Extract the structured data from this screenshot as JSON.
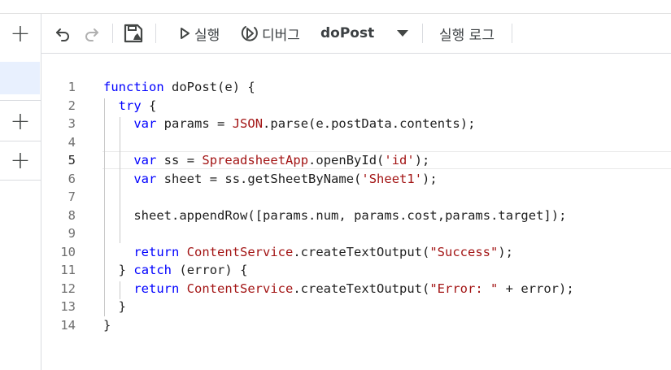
{
  "sidebar": {
    "add_label": "+",
    "add_label_2": "+",
    "add_label_3": "+"
  },
  "toolbar": {
    "undo_icon": "undo-icon",
    "redo_icon": "redo-icon",
    "save_icon": "save-to-drive-icon",
    "run_icon": "play-icon",
    "run_label": "실행",
    "debug_icon": "debug-icon",
    "debug_label": "디버그",
    "function_select": "doPost",
    "log_label": "실행 로그"
  },
  "colors": {
    "keyword": "#0000ff",
    "string": "#a31515",
    "class": "#a31515",
    "plain": "#1f1f1f",
    "line_number": "#6f6f6f"
  },
  "editor": {
    "active_line": 5,
    "lines": [
      {
        "n": "1",
        "text": "function doPost(e) {"
      },
      {
        "n": "2",
        "text": "  try {"
      },
      {
        "n": "3",
        "text": "    var params = JSON.parse(e.postData.contents);"
      },
      {
        "n": "4",
        "text": ""
      },
      {
        "n": "5",
        "text": "    var ss = SpreadsheetApp.openById('id');"
      },
      {
        "n": "6",
        "text": "    var sheet = ss.getSheetByName('Sheet1');"
      },
      {
        "n": "7",
        "text": ""
      },
      {
        "n": "8",
        "text": "    sheet.appendRow([params.num, params.cost,params.target]);"
      },
      {
        "n": "9",
        "text": ""
      },
      {
        "n": "10",
        "text": "    return ContentService.createTextOutput(\"Success\");"
      },
      {
        "n": "11",
        "text": "  } catch (error) {"
      },
      {
        "n": "12",
        "text": "    return ContentService.createTextOutput(\"Error: \" + error);"
      },
      {
        "n": "13",
        "text": "  }"
      },
      {
        "n": "14",
        "text": "}"
      }
    ]
  }
}
